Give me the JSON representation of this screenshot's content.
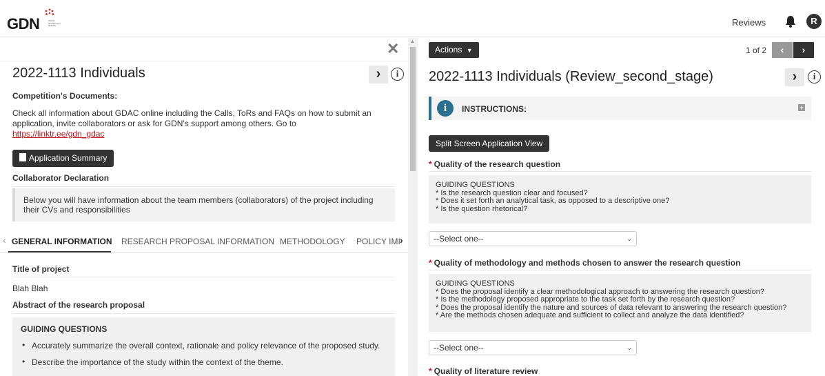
{
  "header": {
    "logo_text": "GDN",
    "logo_tagline": "Global Development Network",
    "reviews_link": "Reviews",
    "avatar_initial": "R"
  },
  "left": {
    "title": "2022-1113 Individuals",
    "competition_docs_label": "Competition's Documents:",
    "competition_docs_text": "Check all information about GDAC online including the Calls, ToRs and FAQs on how to submit an application, invite collaborators or ask for GDN's support among others. Go to",
    "competition_docs_link": "https://linktr.ee/gdn_gdac",
    "app_summary_button": "Application Summary",
    "collaborator_label": "Collaborator Declaration",
    "collaborator_text": "Below you will have information about the team members (collaborators) of the project including their CVs and responsibilities",
    "tabs": [
      "GENERAL INFORMATION",
      "RESEARCH PROPOSAL INFORMATION",
      "METHODOLOGY",
      "POLICY IMI"
    ],
    "project_title_label": "Title of project",
    "project_title_value": "Blah Blah",
    "abstract_label": "Abstract of the research proposal",
    "guiding_header": "GUIDING QUESTIONS",
    "guiding_bullets": [
      "Accurately summarize the overall context, rationale and policy relevance of the proposed study.",
      "Describe the importance of the study within the context of the theme."
    ]
  },
  "right": {
    "actions_button": "Actions",
    "page_count": "1 of 2",
    "title": "2022-1113 Individuals (Review_second_stage)",
    "instructions_label": "INSTRUCTIONS:",
    "split_screen_button": "Split Screen Application View",
    "questions": [
      {
        "label": "Quality of the research question",
        "guiding": [
          "GUIDING QUESTIONS",
          "* Is the research question clear and focused?",
          "* Does it set forth an analytical task, as opposed to a descriptive one?",
          "* Is the question rhetorical?"
        ],
        "select_value": "--Select one--"
      },
      {
        "label": "Quality of methodology and methods chosen to answer the research question",
        "guiding": [
          "GUIDING QUESTIONS",
          "* Does the proposal identify a clear methodological approach to answering the research question?",
          "* Is the methodology proposed appropriate to the task set forth by the research question?",
          "* Does the proposal identify the nature and sources of data relevant to answering the research question?",
          "* Are the methods chosen adequate and sufficient to collect and analyze the data identified?"
        ],
        "select_value": "--Select one--"
      },
      {
        "label": "Quality of literature review"
      }
    ]
  },
  "colors": {
    "accent_red": "#c0151b",
    "info_blue": "#2b6f8f",
    "dark_button": "#333333"
  }
}
